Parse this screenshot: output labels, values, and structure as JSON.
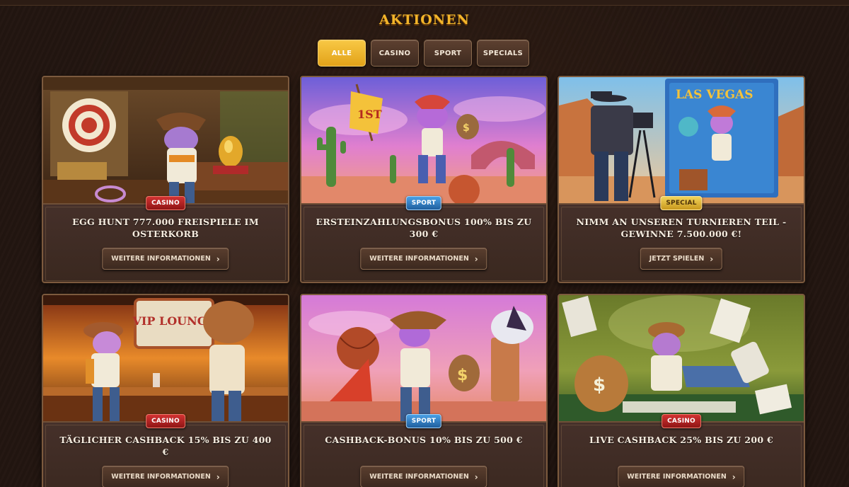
{
  "header": {
    "title": "AKTIONEN"
  },
  "filters": [
    {
      "label": "ALLE",
      "active": true
    },
    {
      "label": "CASINO",
      "active": false
    },
    {
      "label": "SPORT",
      "active": false
    },
    {
      "label": "SPECIALS",
      "active": false
    }
  ],
  "cards": [
    {
      "badge": "CASINO",
      "title": "EGG HUNT 777.000 FREISPIELE IM OSTERKORB",
      "button": "WEITERE INFORMATIONEN"
    },
    {
      "badge": "SPORT",
      "title": "ERSTEINZAHLUNGSBONUS 100% BIS ZU 300 €",
      "button": "WEITERE INFORMATIONEN"
    },
    {
      "badge": "SPECIAL",
      "title": "NIMM AN UNSEREN TURNIEREN TEIL - GEWINNE 7.500.000 €!",
      "button": "JETZT SPIELEN"
    },
    {
      "badge": "CASINO",
      "title": "TÄGLICHER CASHBACK 15% BIS ZU 400 €",
      "button": "WEITERE INFORMATIONEN"
    },
    {
      "badge": "SPORT",
      "title": "CASHBACK-BONUS 10% BIS ZU 500 €",
      "button": "WEITERE INFORMATIONEN"
    },
    {
      "badge": "CASINO",
      "title": "LIVE CASHBACK 25% BIS ZU 200 €",
      "button": "WEITERE INFORMATIONEN"
    }
  ],
  "images": {
    "card1_sign": "",
    "card2_flag": "1ST",
    "card3_sign": "LAS VEGAS",
    "card4_sign": "VIP LOUNGE"
  },
  "colors": {
    "accent": "#f3b52a",
    "casino": "#c42626",
    "sport": "#2f7fc4",
    "special": "#e3b93a"
  },
  "icons": {
    "button_chevron": "chevron-right-icon"
  }
}
